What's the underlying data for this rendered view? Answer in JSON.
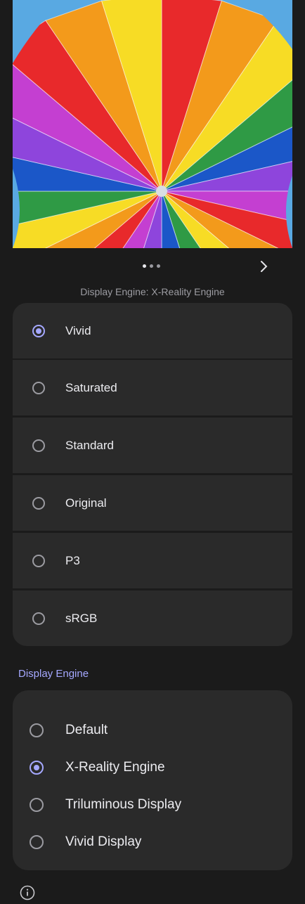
{
  "preview": {
    "image": "rainbow-parachute-photo",
    "colors": [
      "#e8292b",
      "#f39a1b",
      "#f7dc25",
      "#2f9a45",
      "#1b57c8",
      "#8e45dc",
      "#c43fd1"
    ],
    "sky": "#59a9e2"
  },
  "pager": {
    "dots": 3,
    "active_dot": 1,
    "next_icon": "chevron-right-icon"
  },
  "caption": "Display Engine: X-Reality Engine",
  "color_modes": {
    "options": [
      {
        "label": "Vivid",
        "selected": true
      },
      {
        "label": "Saturated",
        "selected": false
      },
      {
        "label": "Standard",
        "selected": false
      },
      {
        "label": "Original",
        "selected": false
      },
      {
        "label": "P3",
        "selected": false
      },
      {
        "label": "sRGB",
        "selected": false
      }
    ]
  },
  "display_engine": {
    "title": "Display Engine",
    "options": [
      {
        "label": "Default",
        "selected": false
      },
      {
        "label": "X-Reality Engine",
        "selected": true
      },
      {
        "label": "Triluminous Display",
        "selected": false
      },
      {
        "label": "Vivid Display",
        "selected": false
      }
    ]
  },
  "info_icon": "info-icon",
  "accent": "#a5a8ff"
}
